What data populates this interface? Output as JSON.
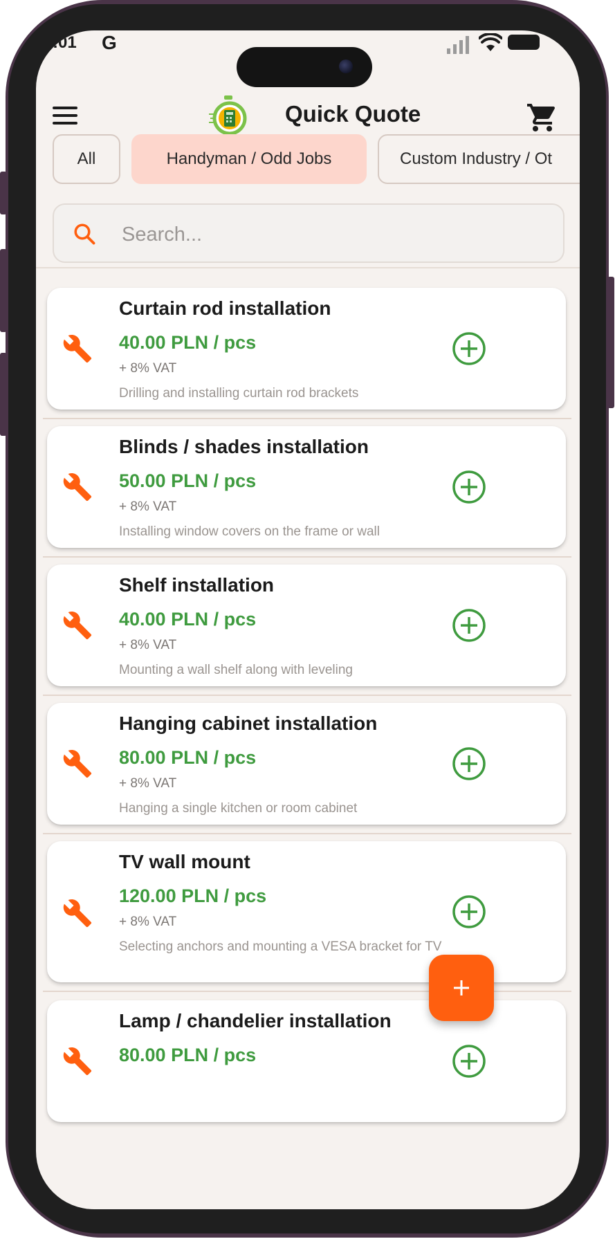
{
  "status_bar": {
    "time": ":01",
    "carrier_icon": "G"
  },
  "app": {
    "title": "Quick Quote"
  },
  "filters": [
    {
      "label": "All",
      "active": false
    },
    {
      "label": "Handyman / Odd Jobs",
      "active": true
    },
    {
      "label": "Custom Industry / Ot",
      "active": false
    }
  ],
  "search": {
    "placeholder": "Search...",
    "value": ""
  },
  "services": [
    {
      "name": "Curtain rod installation",
      "price": "40.00 PLN / pcs",
      "vat": "+ 8% VAT",
      "description": "Drilling and installing curtain rod brackets"
    },
    {
      "name": "Blinds / shades installation",
      "price": "50.00 PLN / pcs",
      "vat": "+ 8% VAT",
      "description": "Installing window covers on the frame or wall"
    },
    {
      "name": "Shelf installation",
      "price": "40.00 PLN / pcs",
      "vat": "+ 8% VAT",
      "description": "Mounting a wall shelf along with leveling"
    },
    {
      "name": "Hanging cabinet installation",
      "price": "80.00 PLN / pcs",
      "vat": "+ 8% VAT",
      "description": "Hanging a single kitchen or room cabinet"
    },
    {
      "name": "TV wall mount",
      "price": "120.00 PLN / pcs",
      "vat": "+ 8% VAT",
      "description": "Selecting anchors and mounting a VESA bracket for TV"
    },
    {
      "name": "Lamp / chandelier installation",
      "price": "80.00 PLN / pcs",
      "vat": "",
      "description": ""
    }
  ],
  "icons": {
    "menu": "hamburger-icon",
    "cart": "cart-icon",
    "search": "search-icon",
    "service": "wrench-icon",
    "add": "add-circle-icon",
    "fab": "plus-icon"
  },
  "colors": {
    "accent": "#ff5f0f",
    "price": "#3f9b3f",
    "chip_active": "#fdd6cc"
  }
}
